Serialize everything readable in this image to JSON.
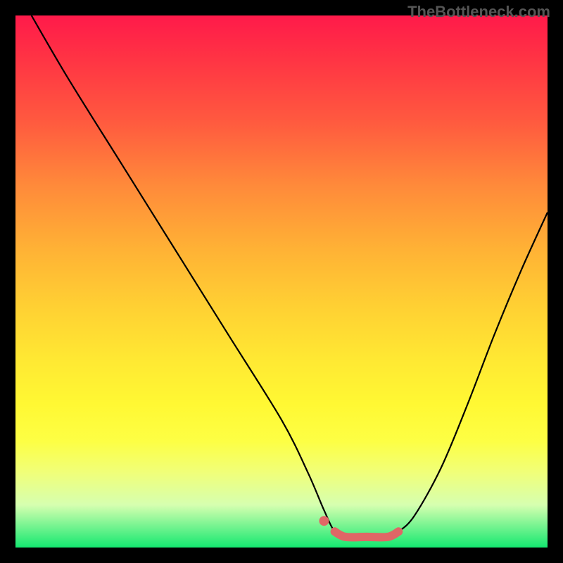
{
  "watermark": "TheBottleneck.com",
  "chart_data": {
    "type": "line",
    "title": "",
    "xlabel": "",
    "ylabel": "",
    "xlim": [
      0,
      100
    ],
    "ylim": [
      0,
      100
    ],
    "series": [
      {
        "name": "curve",
        "x": [
          3,
          10,
          20,
          30,
          40,
          50,
          55,
          58,
          60,
          62,
          66,
          70,
          72,
          75,
          80,
          85,
          90,
          95,
          100
        ],
        "y": [
          100,
          88,
          72,
          56,
          40,
          24,
          14,
          7,
          3,
          2,
          2,
          2,
          3,
          6,
          15,
          27,
          40,
          52,
          63
        ]
      },
      {
        "name": "highlight",
        "x": [
          60,
          62,
          66,
          70,
          72
        ],
        "y": [
          3,
          2,
          2,
          2,
          3
        ]
      },
      {
        "name": "highlight-dot",
        "x": [
          58
        ],
        "y": [
          5
        ]
      }
    ],
    "background_gradient": {
      "top": "#ff1a4a",
      "mid": "#ffe933",
      "bottom": "#14e870"
    }
  }
}
